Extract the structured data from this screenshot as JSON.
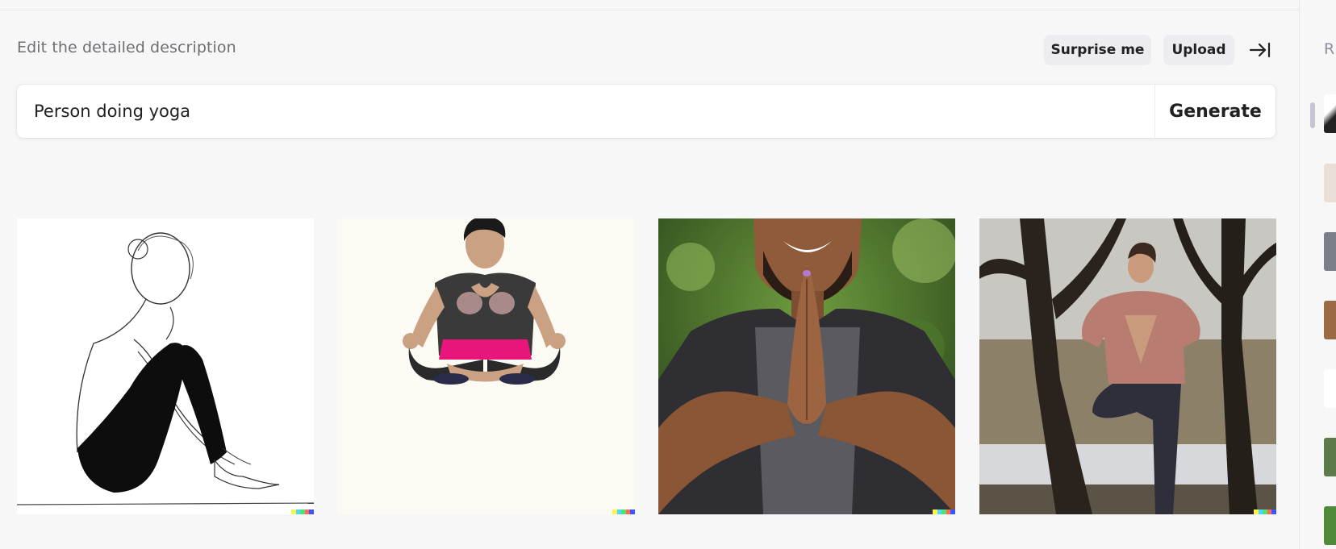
{
  "header": {
    "heading": "Edit the detailed description",
    "surprise_label": "Surprise me",
    "upload_label": "Upload",
    "collapse_icon": "arrow-right-to-bar-icon"
  },
  "prompt": {
    "value": "Person doing yoga",
    "generate_label": "Generate"
  },
  "results": [
    {
      "subject": "pencil sketch of woman sitting hugging knees"
    },
    {
      "subject": "man meditating cross-legged"
    },
    {
      "subject": "smiling man with hands in prayer pose"
    },
    {
      "subject": "man in tree pose outdoors"
    }
  ],
  "signature_colors": [
    "#fff34d",
    "#4ad9ff",
    "#52e07a",
    "#ff6b50",
    "#3e54ff"
  ],
  "history_panel": {
    "label": "R"
  }
}
